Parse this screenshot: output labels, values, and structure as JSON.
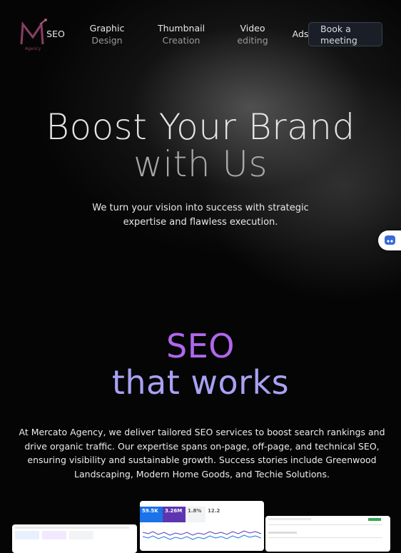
{
  "nav": {
    "logo_text": "Agency",
    "items": [
      {
        "line1": "SEO",
        "line2": ""
      },
      {
        "line1": "Graphic",
        "line2": "Design"
      },
      {
        "line1": "Thumbnail",
        "line2": "Creation"
      },
      {
        "line1": "Video",
        "line2": "editing"
      },
      {
        "line1": "Ads",
        "line2": ""
      }
    ],
    "cta": "Book a meeting"
  },
  "hero": {
    "title_line1": "Boost Your Brand",
    "title_line2": "with Us",
    "subtitle_line1": "We turn your vision into success with strategic",
    "subtitle_line2": "expertise and flawless execution."
  },
  "seo_section": {
    "title_line1": "SEO",
    "title_line2": "that works",
    "description": "At Mercato Agency, we deliver tailored SEO services to boost search rankings and drive organic traffic. Our expertise spans on-page, off-page, and technical SEO, ensuring visibility and sustainable growth. Success stories include Greenwood Landscaping, Modern Home Goods, and Techie Solutions."
  },
  "screenshots": {
    "middle": {
      "clicks": "59.5K",
      "impressions": "3.26M",
      "ctr": "1.8%",
      "position": "12.2"
    }
  },
  "colors": {
    "seo_purple": "#b067ee",
    "seo_lavender": "#a9a1f4",
    "chart_blue": "#1a73e8",
    "chart_purple": "#5e35b1"
  },
  "icons": {
    "chat_widget": "chat-bubble-icon",
    "logo": "m-monogram-logo"
  }
}
